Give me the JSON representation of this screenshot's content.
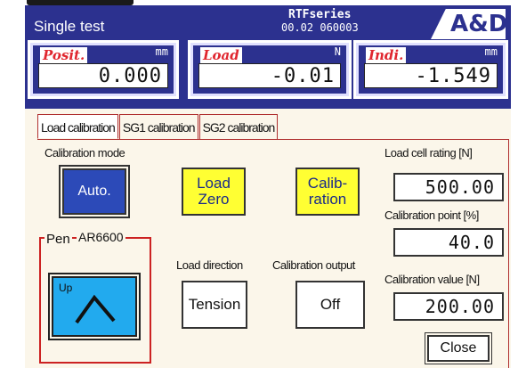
{
  "window": {
    "title": "Single test"
  },
  "device": {
    "series": "RTFseries",
    "version": "00.02 060003",
    "logo": "A&D"
  },
  "readouts": [
    {
      "label": "Posit.",
      "unit": "mm",
      "value": "0.000"
    },
    {
      "label": "Load",
      "unit": "N",
      "value": "-0.01"
    },
    {
      "label": "Indi.",
      "unit": "mm",
      "value": "-1.549"
    }
  ],
  "tabs": [
    {
      "label": "Load calibration",
      "active": true
    },
    {
      "label": "SG1 calibration",
      "active": false
    },
    {
      "label": "SG2 calibration",
      "active": false
    }
  ],
  "calibration": {
    "mode_label": "Calibration mode",
    "auto_button": "Auto.",
    "load_zero_button": "Load\nZero",
    "calibration_button": "Calib-\nration",
    "load_cell_rating_label": "Load cell rating [N]",
    "load_cell_rating_value": "500.00",
    "calibration_point_label": "Calibration point [%]",
    "calibration_point_value": "40.0",
    "calibration_value_label": "Calibration value [N]",
    "calibration_value_value": "200.00",
    "pen_label": "Pen",
    "pen_device": "AR6600",
    "pen_state": "Up",
    "load_direction_label": "Load direction",
    "load_direction_value": "Tension",
    "calibration_output_label": "Calibration output",
    "calibration_output_value": "Off",
    "close_button": "Close"
  },
  "colors": {
    "header_blue": "#2c318f",
    "auto_blue": "#2c4ab8",
    "button_yellow": "#ffff33",
    "pen_cyan": "#22aaee",
    "accent_red": "#e0262f"
  },
  "icons": {
    "pen": "pen-up-caret-icon"
  }
}
